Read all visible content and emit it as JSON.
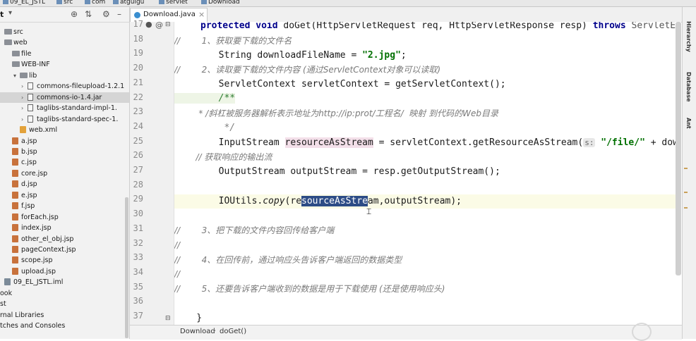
{
  "navbar": {
    "project": "09_EL_JSTL",
    "crumbs": [
      "src",
      "com",
      "atguigu",
      "servlet",
      "Download"
    ]
  },
  "project_panel": {
    "title": "t",
    "tree": [
      {
        "label": "src",
        "icon": "folder-icon",
        "indent": 0
      },
      {
        "label": "web",
        "icon": "folder-icon",
        "indent": 0
      },
      {
        "label": "file",
        "icon": "folder-icon",
        "indent": 1
      },
      {
        "label": "WEB-INF",
        "icon": "folder-icon",
        "indent": 1
      },
      {
        "label": "lib",
        "icon": "folder-icon",
        "indent": 2
      },
      {
        "label": "commons-fileupload-1.2.1",
        "icon": "jar-icon",
        "indent": 3
      },
      {
        "label": "commons-io-1.4.jar",
        "icon": "jar-icon",
        "indent": 3,
        "selected": true
      },
      {
        "label": "taglibs-standard-impl-1.",
        "icon": "jar-icon",
        "indent": 3
      },
      {
        "label": "taglibs-standard-spec-1.",
        "icon": "jar-icon",
        "indent": 3
      },
      {
        "label": "web.xml",
        "icon": "xml-icon",
        "indent": 2
      },
      {
        "label": "a.jsp",
        "icon": "jsp-icon",
        "indent": 1
      },
      {
        "label": "b.jsp",
        "icon": "jsp-icon",
        "indent": 1
      },
      {
        "label": "c.jsp",
        "icon": "jsp-icon",
        "indent": 1
      },
      {
        "label": "core.jsp",
        "icon": "jsp-icon",
        "indent": 1
      },
      {
        "label": "d.jsp",
        "icon": "jsp-icon",
        "indent": 1
      },
      {
        "label": "e.jsp",
        "icon": "jsp-icon",
        "indent": 1
      },
      {
        "label": "f.jsp",
        "icon": "jsp-icon",
        "indent": 1
      },
      {
        "label": "forEach.jsp",
        "icon": "jsp-icon",
        "indent": 1
      },
      {
        "label": "index.jsp",
        "icon": "jsp-icon",
        "indent": 1
      },
      {
        "label": "other_el_obj.jsp",
        "icon": "jsp-icon",
        "indent": 1
      },
      {
        "label": "pageContext.jsp",
        "icon": "jsp-icon",
        "indent": 1
      },
      {
        "label": "scope.jsp",
        "icon": "jsp-icon",
        "indent": 1
      },
      {
        "label": "upload.jsp",
        "icon": "jsp-icon",
        "indent": 1
      },
      {
        "label": "09_EL_JSTL.iml",
        "icon": "iml-icon",
        "indent": 0
      },
      {
        "label": "ook",
        "icon": "",
        "indent": 0
      },
      {
        "label": "st",
        "icon": "",
        "indent": 0
      },
      {
        "label": "rnal Libraries",
        "icon": "",
        "indent": 0
      },
      {
        "label": "tches and Consoles",
        "icon": "",
        "indent": 0
      }
    ]
  },
  "editor": {
    "tab_label": "Download.java",
    "line_numbers": [
      "17",
      "18",
      "19",
      "20",
      "21",
      "22",
      "23",
      "24",
      "25",
      "26",
      "27",
      "28",
      "29",
      "30",
      "31",
      "32",
      "33",
      "34",
      "35",
      "36",
      "37"
    ],
    "current_line": "29",
    "code": {
      "l17_a": "protected void ",
      "l17_b": "doGet(HttpServletRequest req, HttpServletResponse resp) ",
      "l17_c": "throws ",
      "l17_d": "ServletEx",
      "l18": "//        1、获取要下载的文件名",
      "l19_a": "        String downloadFileName = ",
      "l19_b": "\"2.jpg\"",
      "l19_c": ";",
      "l20": "//        2、读取要下载的文件内容 (通过ServletContext对象可以读取)",
      "l21": "        ServletContext servletContext = getServletContext();",
      "l22": "        /**",
      "l23": "         * /斜杠被服务器解析表示地址为http://ip:prot/工程名/  映射 到代码的Web目录",
      "l24": "         */",
      "l25_a": "        InputStream ",
      "l25_b": "resourceAsStream",
      "l25_c": " = servletContext.getResourceAsStream(",
      "l25_hint": "s:",
      "l25_d": " \"/file/\"",
      "l25_e": " + down",
      "l26": "        // 获取响应的输出流",
      "l27": "        OutputStream outputStream = resp.getOutputStream();",
      "l29_a": "        IOUtils.",
      "l29_b": "copy",
      "l29_c": "(re",
      "l29_sel": "sourceAsStre",
      "l29_d": "am",
      "l29_e": ",outputStream);",
      "l31": "//        3、把下载的文件内容回传给客户端",
      "l32": "//",
      "l33": "//        4、在回传前，通过响应头告诉客户端返回的数据类型",
      "l34": "//",
      "l35": "//        5、还要告诉客户端收到的数据是用于下载使用 (还是使用响应头)",
      "l37": "    }"
    }
  },
  "right_tools": [
    "Hierarchy",
    "Database",
    "Ant"
  ],
  "bottom_breadcrumb": [
    "Download",
    "doGet()"
  ],
  "colors": {
    "keyword": "#00008b",
    "string": "#007000",
    "comment": "#808080",
    "selection": "#2d4c86",
    "current_line": "#fbfbe6"
  }
}
